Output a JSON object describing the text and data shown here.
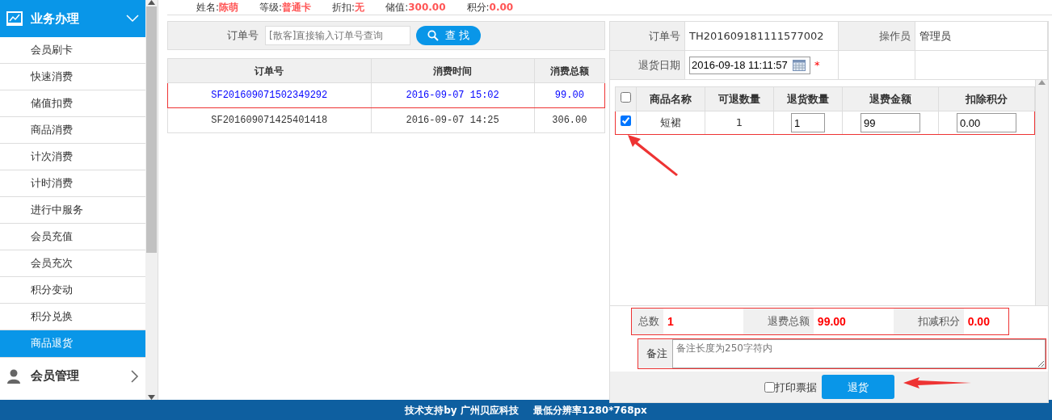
{
  "sidebar": {
    "groups": [
      {
        "title": "业务办理",
        "expanded": true,
        "items": [
          {
            "label": "会员刷卡",
            "selected": false
          },
          {
            "label": "快速消费",
            "selected": false
          },
          {
            "label": "储值扣费",
            "selected": false
          },
          {
            "label": "商品消费",
            "selected": false
          },
          {
            "label": "计次消费",
            "selected": false
          },
          {
            "label": "计时消费",
            "selected": false
          },
          {
            "label": "进行中服务",
            "selected": false
          },
          {
            "label": "会员充值",
            "selected": false
          },
          {
            "label": "会员充次",
            "selected": false
          },
          {
            "label": "积分变动",
            "selected": false
          },
          {
            "label": "积分兑换",
            "selected": false
          },
          {
            "label": "商品退货",
            "selected": true
          }
        ]
      },
      {
        "title": "会员管理",
        "expanded": false
      }
    ]
  },
  "member_info": [
    {
      "label": "姓名:",
      "value": "陈萌"
    },
    {
      "label": "等级:",
      "value": "普通卡"
    },
    {
      "label": "折扣:",
      "value": "无"
    },
    {
      "label": "储值:",
      "value": "300.00"
    },
    {
      "label": "积分:",
      "value": "0.00"
    }
  ],
  "search": {
    "label": "订单号",
    "placeholder": "[散客]直接输入订单号查询",
    "button": "查 找"
  },
  "orders": {
    "columns": [
      "订单号",
      "消费时间",
      "消费总额"
    ],
    "rows": [
      {
        "cells": [
          "SF201609071502349292",
          "2016-09-07 15:02",
          "99.00"
        ],
        "selected": true
      },
      {
        "cells": [
          "SF201609071425401418",
          "2016-09-07 14:25",
          "306.00"
        ],
        "selected": false
      }
    ]
  },
  "return_form": {
    "order_label": "订单号",
    "order_no": "TH201609181111577002",
    "operator_label": "操作员",
    "operator": "管理员",
    "date_label": "退货日期",
    "date": "2016-09-18 11:11:57",
    "required_mark": "*"
  },
  "items": {
    "all_checked": false,
    "columns": [
      "商品名称",
      "可退数量",
      "退货数量",
      "退费金额",
      "扣除积分"
    ],
    "rows": [
      {
        "checked": true,
        "name": "短裙",
        "available": "1",
        "qty": "1",
        "amount": "99",
        "points": "0.00"
      }
    ]
  },
  "totals": [
    {
      "label": "总数",
      "value": "1"
    },
    {
      "label": "退费总额",
      "value": "99.00"
    },
    {
      "label": "扣减积分",
      "value": "0.00"
    }
  ],
  "remark": {
    "label": "备注",
    "placeholder": "备注长度为250字符内"
  },
  "print_receipt": {
    "label": "打印票据",
    "checked": false
  },
  "submit": "退货",
  "footer": {
    "support": "技术支持by 广州贝应科技",
    "resolution": "最低分辨率1280*768px"
  }
}
